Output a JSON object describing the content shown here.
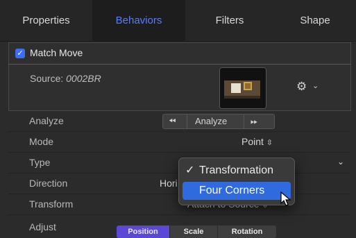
{
  "tabs": [
    {
      "label": "Properties"
    },
    {
      "label": "Behaviors",
      "active": true
    },
    {
      "label": "Filters"
    },
    {
      "label": "Shape"
    }
  ],
  "section": {
    "title": "Match Move",
    "checked": true
  },
  "source": {
    "label_prefix": "Source: ",
    "label_value": "0002BR"
  },
  "analyze": {
    "label": "Analyze",
    "button": "Analyze",
    "rewind_icon": "rewind-icon",
    "forward_icon": "fast-forward-icon"
  },
  "mode": {
    "label": "Mode",
    "value": "Point"
  },
  "type": {
    "label": "Type"
  },
  "direction": {
    "label": "Direction",
    "value": "Hori"
  },
  "transform": {
    "label": "Transform",
    "value": "Attach to Source"
  },
  "adjust": {
    "label": "Adjust",
    "buttons": [
      "Position",
      "Scale",
      "Rotation"
    ]
  },
  "menu": {
    "items": [
      {
        "label": "Transformation",
        "checked": true
      },
      {
        "label": "Four Corners",
        "highlighted": true
      }
    ]
  },
  "colors": {
    "accent": "#5b7cf7",
    "highlight": "#2f6bde",
    "bg": "#2b2b2b"
  }
}
